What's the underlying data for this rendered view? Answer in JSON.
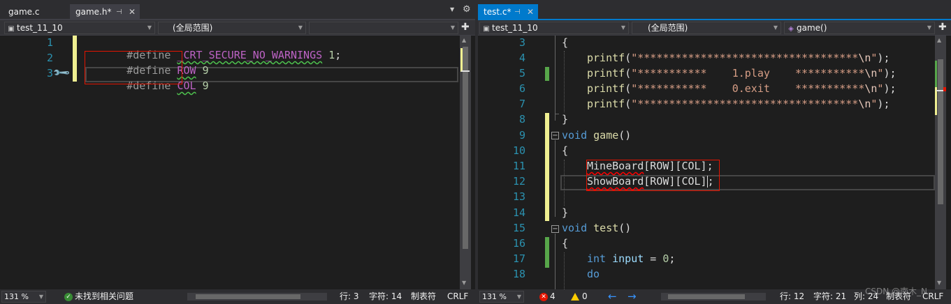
{
  "left": {
    "tabs": [
      {
        "label": "game.c"
      },
      {
        "label": "game.h*"
      }
    ],
    "nav": {
      "project": "test_11_10",
      "scope": "(全局范围)",
      "member": ""
    },
    "lines": [
      {
        "num": "1",
        "code": "#define _CRT_SECURE_NO_WARNINGS 1;"
      },
      {
        "num": "2",
        "code": "#define ROW 9"
      },
      {
        "num": "3",
        "code": "#define COL 9"
      }
    ],
    "status": {
      "zoom": "131 %",
      "issues": "未找到相关问题",
      "line": "行: 3",
      "char": "字符: 14",
      "tabs": "制表符",
      "eol": "CRLF"
    }
  },
  "right": {
    "tabs": [
      {
        "label": "test.c*"
      }
    ],
    "nav": {
      "project": "test_11_10",
      "scope": "(全局范围)",
      "member": "game()"
    },
    "line_numbers": [
      "3",
      "4",
      "5",
      "6",
      "7",
      "8",
      "9",
      "10",
      "11",
      "12",
      "13",
      "14",
      "15",
      "16",
      "17",
      "18"
    ],
    "code": {
      "l3": "{",
      "l4_fn": "printf",
      "l4_str": "\"***********************************",
      "l4_esc": "\\n",
      "l5_str": "\"***********    1.play    ***********",
      "l6_str": "\"***********    0.exit    ***********",
      "l7_str": "\"***********************************",
      "str_close": "\"",
      "call_tail": ");",
      "open_paren": "(",
      "l8": "}",
      "l9_kw": "void",
      "l9_fn": "game",
      "parens": "()",
      "l10": "{",
      "l11_fn": "MineBoard",
      "l11_tail": "[ROW][COL];",
      "l12_fn": "ShowBoard",
      "l12_tail": "[ROW][COL]",
      "semicolon": ";",
      "l14": "}",
      "l15_kw": "void",
      "l15_fn": "test",
      "l16": "{",
      "l17_kw": "int",
      "l17_var": "input",
      "l17_eq": " = ",
      "l17_num": "0",
      "l18_kw": "do"
    },
    "status": {
      "zoom": "131 %",
      "errors": "4",
      "warnings": "0",
      "line": "行: 12",
      "char": "字符: 21",
      "col": "列: 24",
      "tabs": "制表符",
      "eol": "CRLF"
    }
  },
  "watermark": "CSDN @南木_N",
  "icons": {
    "pin": "pin-icon",
    "close": "close-icon",
    "dropdown": "chevron-down-icon",
    "gear": "gear-icon",
    "split": "split-editor-icon",
    "quick_action": "screwdriver-icon",
    "method": "method-cube-icon",
    "ok": "checkmark-circle-icon",
    "error": "error-icon",
    "warning": "warning-icon",
    "back": "arrow-left-icon",
    "forward": "arrow-right-icon"
  },
  "colors": {
    "background": "#1e1e1e",
    "accent": "#007acc",
    "keyword": "#569cd6",
    "macro": "#bd63c5",
    "string": "#d69d85",
    "line_number": "#2b91af",
    "change_saved": "#57a64a",
    "change_unsaved": "#efef91",
    "error": "#e51400"
  }
}
